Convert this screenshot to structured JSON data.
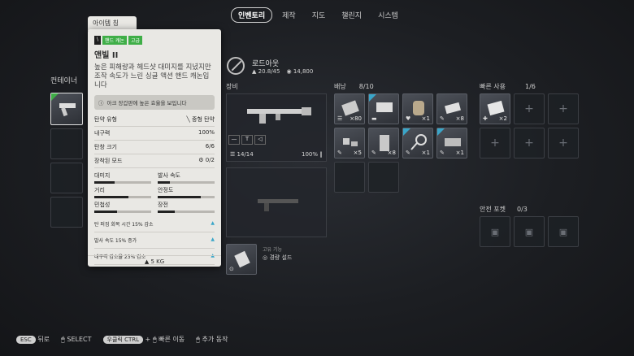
{
  "topnav": {
    "tabs": [
      {
        "label": "인벤토리",
        "active": true
      },
      {
        "label": "제작",
        "active": false
      },
      {
        "label": "지도",
        "active": false
      },
      {
        "label": "챌린지",
        "active": false
      },
      {
        "label": "시스템",
        "active": false
      }
    ]
  },
  "container": {
    "label": "컨테이너"
  },
  "tooltip": {
    "tab_label": "아이템 칭",
    "tags": [
      "핸드 캐논",
      "고급"
    ],
    "title": "앤빌 II",
    "description": "높은 피해량과 헤드샷 대미지를 지녔지만 조작 속도가 느린 싱글 액션 핸드 캐논입니다",
    "note": "아크 장갑판에 높은 효율을 보입니다",
    "rows": [
      {
        "label": "탄약 유형",
        "value": "중형 탄약"
      },
      {
        "label": "내구력",
        "value": "100%"
      },
      {
        "label": "탄창 크기",
        "value": "6/6"
      },
      {
        "label": "장착된 모드",
        "value": "0/2"
      }
    ],
    "bars": [
      {
        "label": "대미지",
        "value": 0.35
      },
      {
        "label": "발사 속도",
        "value": 0.22
      },
      {
        "label": "거리",
        "value": 0.6
      },
      {
        "label": "안정도",
        "value": 0.75
      },
      {
        "label": "민첩성",
        "value": 0.4
      },
      {
        "label": "장전",
        "value": 0.3
      }
    ],
    "perks": [
      "탄 퍼짐 회복 시간 15% 감소",
      "발사 속도 15% 증가",
      "내구력 감소율 23% 감소"
    ],
    "weight": "5 KG"
  },
  "player": {
    "name": "로드아웃",
    "weight": "20.8/45",
    "currency": "14,800"
  },
  "equipment": {
    "label": "장비",
    "ammo": "14/14",
    "durability": "100%",
    "special_label": "고유 기능",
    "special_value": "경량 설드"
  },
  "backpack": {
    "label": "배낭",
    "count": "8/10",
    "items": [
      {
        "qty": "×80"
      },
      {
        "qty": ""
      },
      {
        "qty": "×1"
      },
      {
        "qty": "×8"
      },
      {
        "qty": "×5"
      },
      {
        "qty": "×8"
      },
      {
        "qty": "×1"
      },
      {
        "qty": "×1"
      }
    ]
  },
  "quick_use": {
    "label": "빠른 사용",
    "count": "1/6",
    "first_qty": "×2"
  },
  "safe_pocket": {
    "label": "안전 포켓",
    "count": "0/3"
  },
  "bottom": {
    "back_key": "ESC",
    "back_label": "뒤로",
    "select_label": "SELECT",
    "quick_key": "우클릭 CTRL",
    "quick_label": "빠른 이동",
    "more_label": "추가 동작"
  }
}
